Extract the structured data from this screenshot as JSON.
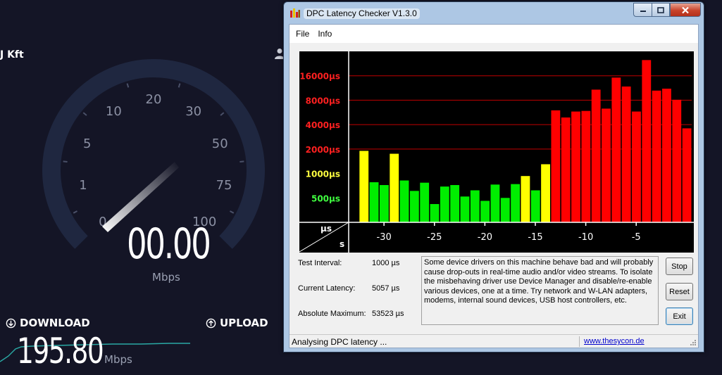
{
  "speedtest": {
    "isp": "J Kft",
    "gauge_ticks": [
      "0",
      "1",
      "5",
      "10",
      "20",
      "30",
      "50",
      "75",
      "100"
    ],
    "current_value": "00.00",
    "current_unit": "Mbps",
    "download_label": "DOWNLOAD",
    "upload_label": "UPLOAD",
    "download_value": "195.80",
    "download_unit": "Mbps",
    "colors": {
      "background": "#141526",
      "gauge_track": "#1f2740",
      "accent": "#2fd0c6"
    }
  },
  "window": {
    "title": "DPC Latency Checker V1.3.0",
    "menu": [
      "File",
      "Info"
    ]
  },
  "chart_data": {
    "type": "bar",
    "y_tick_labels": [
      {
        "label": "16000µs",
        "value": 16000,
        "color": "#ff2020"
      },
      {
        "label": "8000µs",
        "value": 8000,
        "color": "#ff2020"
      },
      {
        "label": "4000µs",
        "value": 4000,
        "color": "#ff2020"
      },
      {
        "label": "2000µs",
        "value": 2000,
        "color": "#ff2020"
      },
      {
        "label": "1000µs",
        "value": 1000,
        "color": "#ffff40"
      },
      {
        "label": "500µs",
        "value": 500,
        "color": "#40ff40"
      }
    ],
    "x_tick_labels": [
      {
        "label": "-30",
        "value": -30
      },
      {
        "label": "-25",
        "value": -25
      },
      {
        "label": "-20",
        "value": -20
      },
      {
        "label": "-15",
        "value": -15
      },
      {
        "label": "-10",
        "value": -10
      },
      {
        "label": "-5",
        "value": -5
      }
    ],
    "corner_y_unit": "µs",
    "corner_x_unit": "s",
    "x_range": [
      -33,
      0
    ],
    "y_scale": "log2",
    "y_range": [
      250,
      32000
    ],
    "grid": true,
    "colors": {
      "green": "#00ee00",
      "yellow": "#ffff00",
      "red": "#ff0000",
      "background": "#000000",
      "grid": "#c00000",
      "axis": "#ffffff"
    },
    "bars": [
      {
        "x": -32,
        "value": 1900,
        "color": "yellow"
      },
      {
        "x": -31,
        "value": 780,
        "color": "green"
      },
      {
        "x": -30,
        "value": 720,
        "color": "green"
      },
      {
        "x": -29,
        "value": 1750,
        "color": "yellow"
      },
      {
        "x": -28,
        "value": 820,
        "color": "green"
      },
      {
        "x": -27,
        "value": 610,
        "color": "green"
      },
      {
        "x": -26,
        "value": 770,
        "color": "green"
      },
      {
        "x": -25,
        "value": 420,
        "color": "green"
      },
      {
        "x": -24,
        "value": 690,
        "color": "green"
      },
      {
        "x": -23,
        "value": 720,
        "color": "green"
      },
      {
        "x": -22,
        "value": 520,
        "color": "green"
      },
      {
        "x": -21,
        "value": 620,
        "color": "green"
      },
      {
        "x": -20,
        "value": 460,
        "color": "green"
      },
      {
        "x": -19,
        "value": 730,
        "color": "green"
      },
      {
        "x": -18,
        "value": 500,
        "color": "green"
      },
      {
        "x": -17,
        "value": 740,
        "color": "green"
      },
      {
        "x": -16,
        "value": 930,
        "color": "yellow"
      },
      {
        "x": -15,
        "value": 620,
        "color": "green"
      },
      {
        "x": -14,
        "value": 1300,
        "color": "yellow"
      },
      {
        "x": -13,
        "value": 6000,
        "color": "red"
      },
      {
        "x": -12,
        "value": 4900,
        "color": "red"
      },
      {
        "x": -11,
        "value": 5800,
        "color": "red"
      },
      {
        "x": -10,
        "value": 5900,
        "color": "red"
      },
      {
        "x": -9,
        "value": 10800,
        "color": "red"
      },
      {
        "x": -8,
        "value": 6300,
        "color": "red"
      },
      {
        "x": -7,
        "value": 15200,
        "color": "red"
      },
      {
        "x": -6,
        "value": 11800,
        "color": "red"
      },
      {
        "x": -5,
        "value": 5800,
        "color": "red"
      },
      {
        "x": -4,
        "value": 25000,
        "color": "red"
      },
      {
        "x": -3,
        "value": 10500,
        "color": "red"
      },
      {
        "x": -2,
        "value": 11100,
        "color": "red"
      },
      {
        "x": -1,
        "value": 8100,
        "color": "red"
      },
      {
        "x": 0,
        "value": 3600,
        "color": "red"
      }
    ]
  },
  "info": {
    "test_interval_label": "Test Interval:",
    "test_interval_value": "1000 µs",
    "current_latency_label": "Current Latency:",
    "current_latency_value": "5057 µs",
    "absolute_maximum_label": "Absolute Maximum:",
    "absolute_maximum_value": "53523 µs",
    "message": "Some device drivers on this machine behave bad and will probably cause drop-outs in real-time audio and/or video streams. To isolate the misbehaving driver use Device Manager and disable/re-enable various devices, one at a time. Try network and W-LAN adapters, modems, internal sound devices, USB host controllers, etc."
  },
  "buttons": {
    "stop": "Stop",
    "reset": "Reset",
    "exit": "Exit"
  },
  "status": {
    "text": "Analysing DPC latency ...",
    "link": "www.thesycon.de"
  }
}
